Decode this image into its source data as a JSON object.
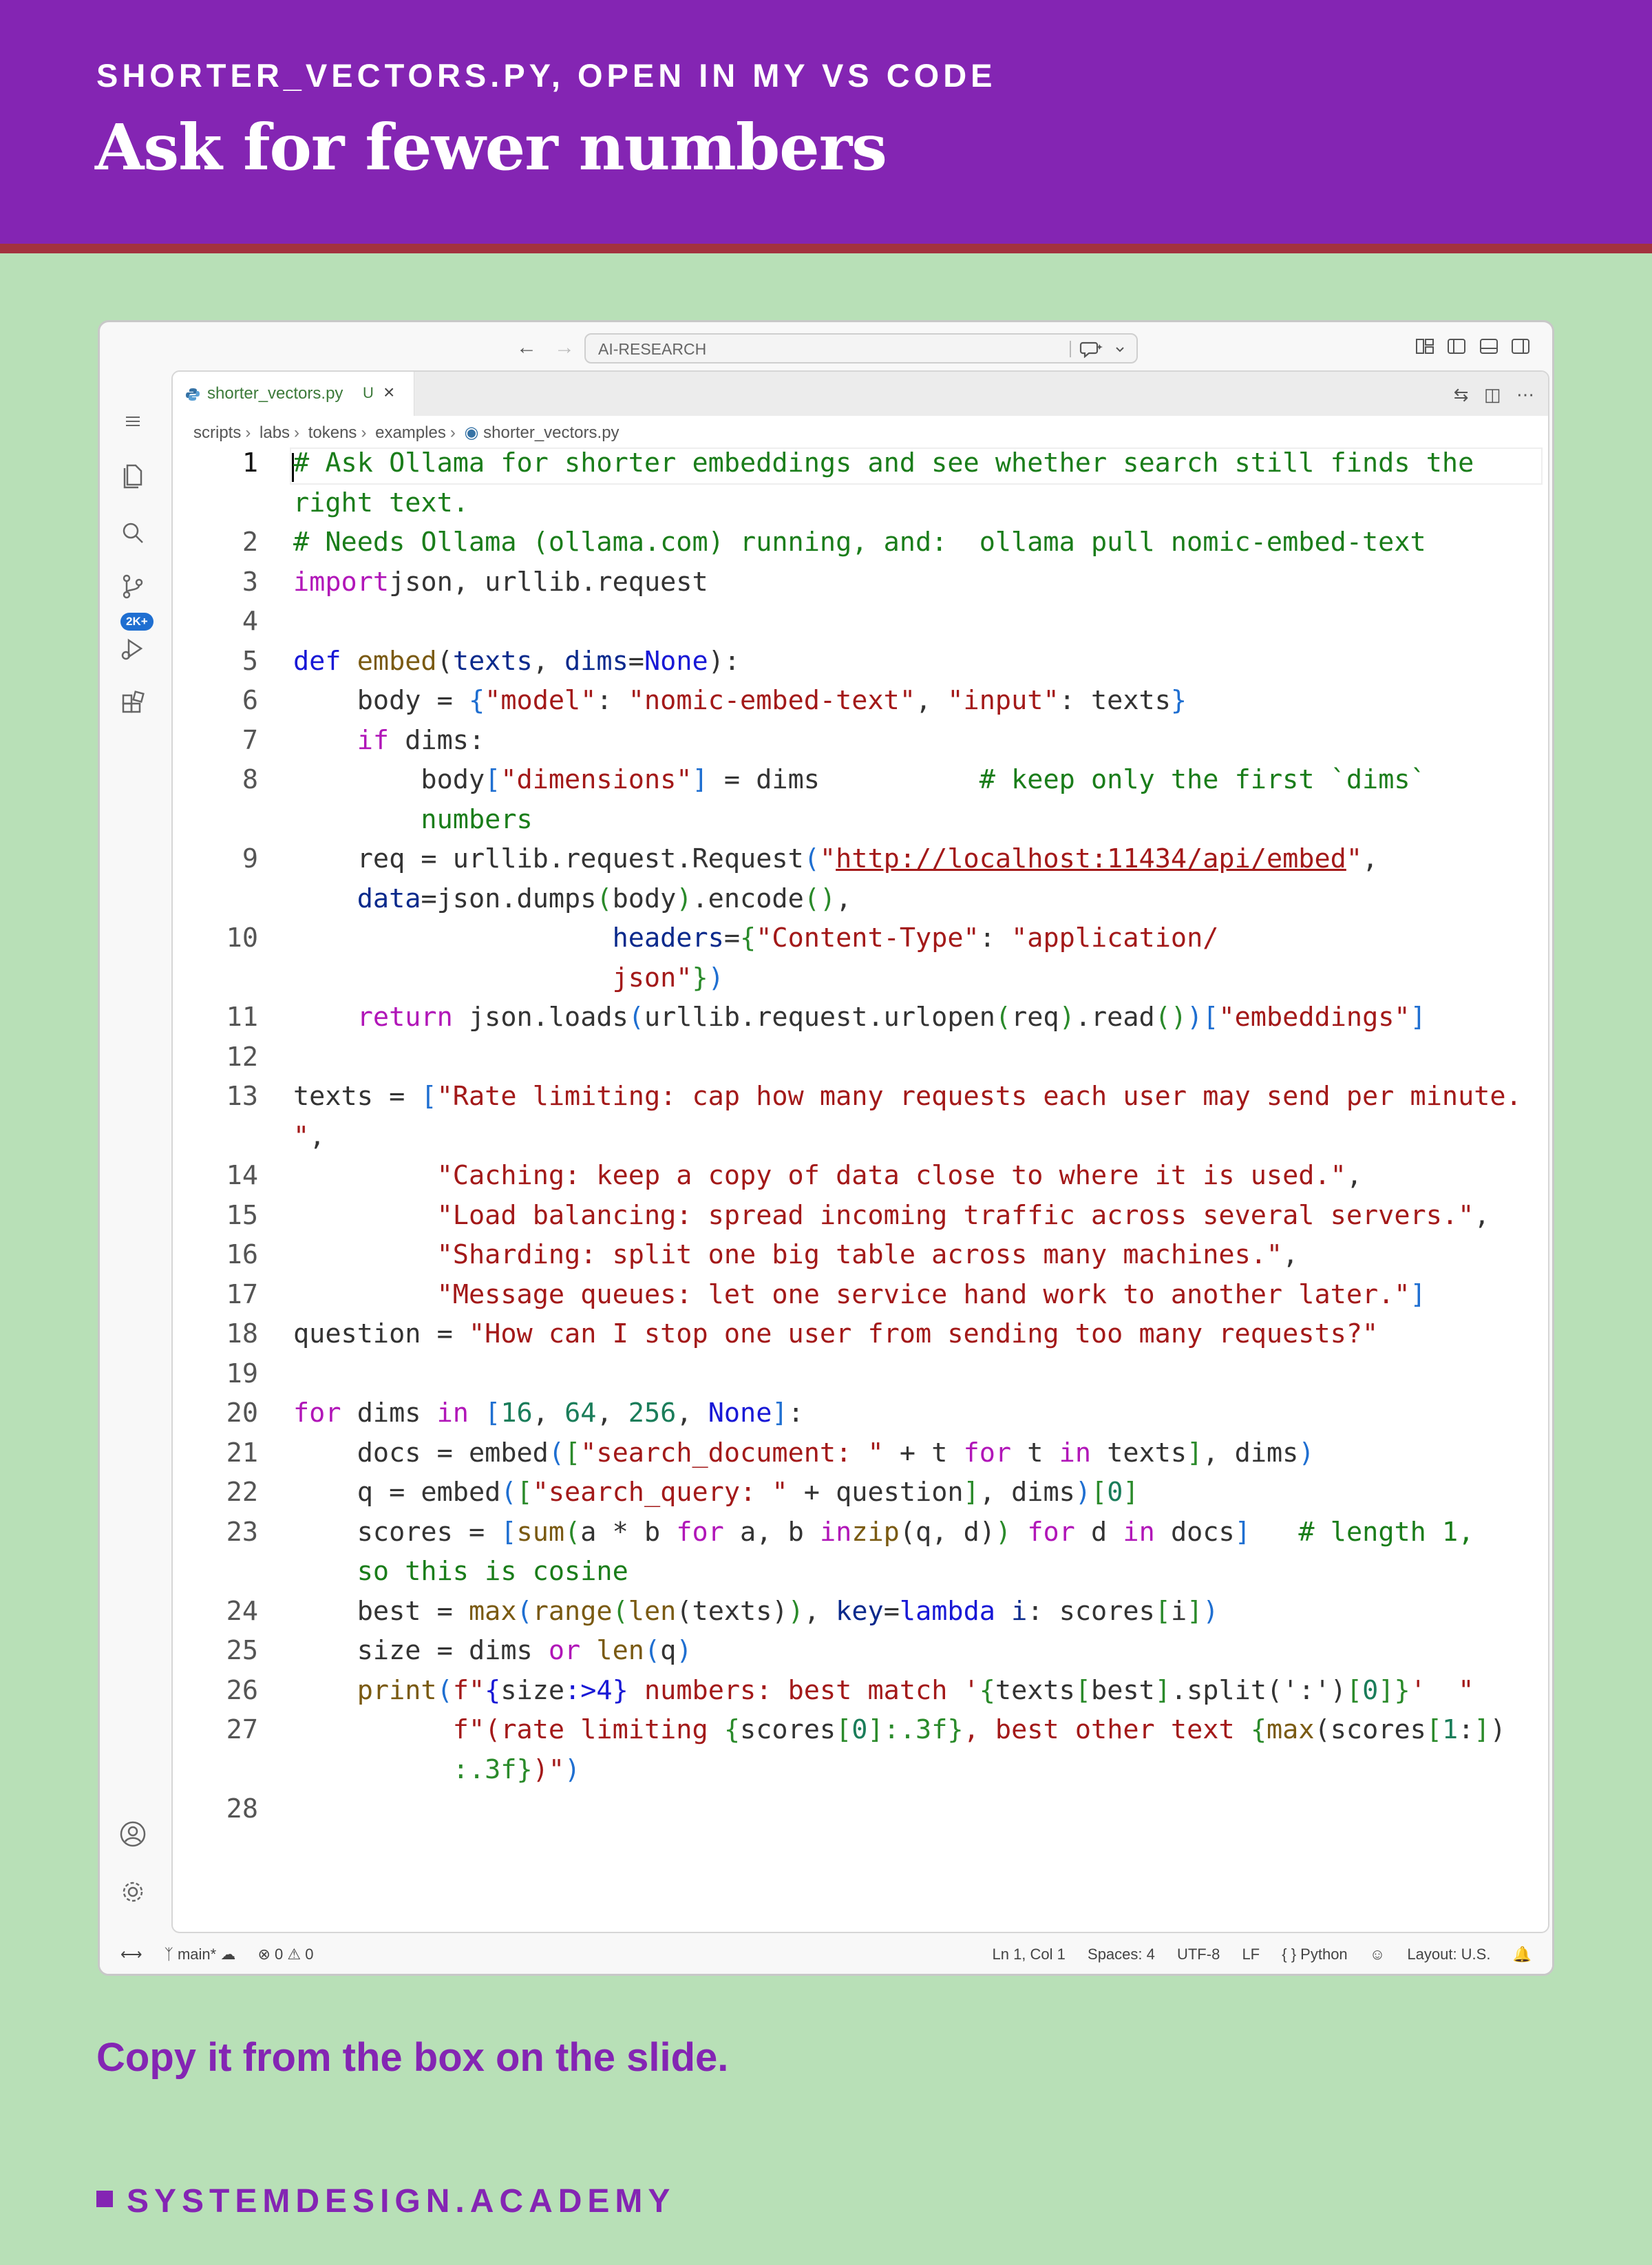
{
  "slide": {
    "kicker": "SHORTER_VECTORS.PY, OPEN IN MY VS CODE",
    "title": "Ask for fewer numbers",
    "note": "Copy it from the box on the slide.",
    "brand": "SYSTEMDESIGN.ACADEMY"
  },
  "window": {
    "command_center": "AI-RESEARCH",
    "activity_badge": "2K+"
  },
  "tab": {
    "label": "shorter_vectors.py",
    "status": "U"
  },
  "breadcrumb": [
    "scripts",
    "labs",
    "tokens",
    "examples",
    "shorter_vectors.py"
  ],
  "code_lines": [
    {
      "n": "1",
      "rows": [
        [
          [
            "c",
            "# Ask Ollama for shorter embeddings and see whether search still finds the"
          ]
        ],
        [
          [
            "c",
            "right text."
          ]
        ]
      ]
    },
    {
      "n": "2",
      "rows": [
        [
          [
            "c",
            "# Needs Ollama (ollama.com) running, and:  ollama pull nomic-embed-text"
          ]
        ]
      ]
    },
    {
      "n": "3",
      "rows": [
        [
          [
            "k",
            "import"
          ],
          [
            "",
            "json, urllib.request"
          ]
        ]
      ]
    },
    {
      "n": "4",
      "rows": [
        [
          [
            "",
            ""
          ]
        ]
      ]
    },
    {
      "n": "5",
      "rows": [
        [
          [
            "b",
            "def "
          ],
          [
            "f",
            "embed"
          ],
          [
            "",
            "("
          ],
          [
            "v",
            "texts"
          ],
          [
            "",
            ", "
          ],
          [
            "v",
            "dims"
          ],
          [
            "",
            "="
          ],
          [
            "b",
            "None"
          ],
          [
            "",
            "):"
          ]
        ]
      ]
    },
    {
      "n": "6",
      "rows": [
        [
          [
            "",
            "    body = "
          ],
          [
            "bl",
            "{"
          ],
          [
            "s",
            "\"model\""
          ],
          [
            "",
            ": "
          ],
          [
            "s",
            "\"nomic-embed-text\""
          ],
          [
            "",
            ", "
          ],
          [
            "s",
            "\"input\""
          ],
          [
            "",
            ": texts"
          ],
          [
            "bl",
            "}"
          ]
        ]
      ]
    },
    {
      "n": "7",
      "rows": [
        [
          [
            "",
            "    "
          ],
          [
            "k",
            "if"
          ],
          [
            "",
            " dims:"
          ]
        ]
      ]
    },
    {
      "n": "8",
      "rows": [
        [
          [
            "",
            "        body"
          ],
          [
            "bl",
            "["
          ],
          [
            "s",
            "\"dimensions\""
          ],
          [
            "bl",
            "]"
          ],
          [
            "",
            " = dims          "
          ],
          [
            "c",
            "# keep only the first `dims`"
          ]
        ],
        [
          [
            "c",
            "        numbers"
          ]
        ]
      ]
    },
    {
      "n": "9",
      "rows": [
        [
          [
            "",
            "    req = urllib.request.Request"
          ],
          [
            "bl",
            "("
          ],
          [
            "s",
            "\""
          ],
          [
            "su",
            "http://localhost:11434/api/embed"
          ],
          [
            "s",
            "\""
          ],
          [
            "",
            ","
          ]
        ],
        [
          [
            "",
            "    "
          ],
          [
            "v",
            "data"
          ],
          [
            "",
            "=json.dumps"
          ],
          [
            "g",
            "("
          ],
          [
            "",
            "body"
          ],
          [
            "g",
            ")"
          ],
          [
            "",
            ".encode"
          ],
          [
            "g",
            "()"
          ],
          [
            "",
            ","
          ]
        ]
      ]
    },
    {
      "n": "10",
      "rows": [
        [
          [
            "",
            "                    "
          ],
          [
            "v",
            "headers"
          ],
          [
            "",
            "="
          ],
          [
            "g",
            "{"
          ],
          [
            "s",
            "\"Content-Type\""
          ],
          [
            "",
            ": "
          ],
          [
            "s",
            "\"application/"
          ]
        ],
        [
          [
            "s",
            "                    json\""
          ],
          [
            "g",
            "}"
          ],
          [
            "bl",
            ")"
          ]
        ]
      ]
    },
    {
      "n": "11",
      "rows": [
        [
          [
            "",
            "    "
          ],
          [
            "k",
            "return"
          ],
          [
            "",
            " json.loads"
          ],
          [
            "bl",
            "("
          ],
          [
            "",
            "urllib.request.urlopen"
          ],
          [
            "g",
            "("
          ],
          [
            "",
            "req"
          ],
          [
            "g",
            ")"
          ],
          [
            "",
            ".read"
          ],
          [
            "g",
            "()"
          ],
          [
            "bl",
            ")"
          ],
          [
            "bl",
            "["
          ],
          [
            "s",
            "\"embeddings\""
          ],
          [
            "bl",
            "]"
          ]
        ]
      ]
    },
    {
      "n": "12",
      "rows": [
        [
          [
            "",
            ""
          ]
        ]
      ]
    },
    {
      "n": "13",
      "rows": [
        [
          [
            "",
            "texts = "
          ],
          [
            "bl",
            "["
          ],
          [
            "s",
            "\"Rate limiting: cap how many requests each user may send per minute."
          ]
        ],
        [
          [
            "s",
            "\""
          ],
          [
            "",
            ","
          ]
        ]
      ]
    },
    {
      "n": "14",
      "rows": [
        [
          [
            "",
            "         "
          ],
          [
            "s",
            "\"Caching: keep a copy of data close to where it is used.\""
          ],
          [
            "",
            ","
          ]
        ]
      ]
    },
    {
      "n": "15",
      "rows": [
        [
          [
            "",
            "         "
          ],
          [
            "s",
            "\"Load balancing: spread incoming traffic across several servers.\""
          ],
          [
            "",
            ","
          ]
        ]
      ]
    },
    {
      "n": "16",
      "rows": [
        [
          [
            "",
            "         "
          ],
          [
            "s",
            "\"Sharding: split one big table across many machines.\""
          ],
          [
            "",
            ","
          ]
        ]
      ]
    },
    {
      "n": "17",
      "rows": [
        [
          [
            "",
            "         "
          ],
          [
            "s",
            "\"Message queues: let one service hand work to another later.\""
          ],
          [
            "bl",
            "]"
          ]
        ]
      ]
    },
    {
      "n": "18",
      "rows": [
        [
          [
            "",
            "question = "
          ],
          [
            "s",
            "\"How can I stop one user from sending too many requests?\""
          ]
        ]
      ]
    },
    {
      "n": "19",
      "rows": [
        [
          [
            "",
            ""
          ]
        ]
      ]
    },
    {
      "n": "20",
      "rows": [
        [
          [
            "k",
            "for"
          ],
          [
            "",
            " dims "
          ],
          [
            "k",
            "in"
          ],
          [
            "",
            " "
          ],
          [
            "bl",
            "["
          ],
          [
            "n",
            "16"
          ],
          [
            "",
            ", "
          ],
          [
            "n",
            "64"
          ],
          [
            "",
            ", "
          ],
          [
            "n",
            "256"
          ],
          [
            "",
            ", "
          ],
          [
            "b",
            "None"
          ],
          [
            "bl",
            "]"
          ],
          [
            "",
            ":"
          ]
        ]
      ]
    },
    {
      "n": "21",
      "rows": [
        [
          [
            "",
            "    docs = embed"
          ],
          [
            "bl",
            "("
          ],
          [
            "g",
            "["
          ],
          [
            "s",
            "\"search_document: \""
          ],
          [
            "",
            " + t "
          ],
          [
            "k",
            "for"
          ],
          [
            "",
            " t "
          ],
          [
            "k",
            "in"
          ],
          [
            "",
            " texts"
          ],
          [
            "g",
            "]"
          ],
          [
            "",
            ", dims"
          ],
          [
            "bl",
            ")"
          ]
        ]
      ]
    },
    {
      "n": "22",
      "rows": [
        [
          [
            "",
            "    q = embed"
          ],
          [
            "bl",
            "("
          ],
          [
            "g",
            "["
          ],
          [
            "s",
            "\"search_query: \""
          ],
          [
            "",
            " + question"
          ],
          [
            "g",
            "]"
          ],
          [
            "",
            ", dims"
          ],
          [
            "bl",
            ")"
          ],
          [
            "g",
            "["
          ],
          [
            "n",
            "0"
          ],
          [
            "g",
            "]"
          ]
        ]
      ]
    },
    {
      "n": "23",
      "rows": [
        [
          [
            "",
            "    scores = "
          ],
          [
            "bl",
            "["
          ],
          [
            "f",
            "sum"
          ],
          [
            "g",
            "("
          ],
          [
            "",
            "a * b "
          ],
          [
            "k",
            "for"
          ],
          [
            "",
            " a, b "
          ],
          [
            "k",
            "in"
          ],
          [
            " f",
            "zip"
          ],
          [
            "",
            "("
          ],
          [
            "",
            "q, d"
          ],
          [
            "",
            ")"
          ],
          [
            "g",
            ")"
          ],
          [
            "",
            " "
          ],
          [
            "k",
            "for"
          ],
          [
            "",
            " d "
          ],
          [
            "k",
            "in"
          ],
          [
            "",
            " docs"
          ],
          [
            "bl",
            "]"
          ],
          [
            "",
            "   "
          ],
          [
            "c",
            "# length 1,"
          ]
        ],
        [
          [
            "c",
            "    so this is cosine"
          ]
        ]
      ]
    },
    {
      "n": "24",
      "rows": [
        [
          [
            "",
            "    best = "
          ],
          [
            "f",
            "max"
          ],
          [
            "bl",
            "("
          ],
          [
            "f",
            "range"
          ],
          [
            "g",
            "("
          ],
          [
            "f",
            "len"
          ],
          [
            "",
            "(texts)"
          ],
          [
            "g",
            ")"
          ],
          [
            "",
            ", "
          ],
          [
            "v",
            "key"
          ],
          [
            "",
            "="
          ],
          [
            "b",
            "lambda"
          ],
          [
            "",
            " "
          ],
          [
            "v",
            "i"
          ],
          [
            "",
            ": scores"
          ],
          [
            "g",
            "["
          ],
          [
            "",
            "i"
          ],
          [
            "g",
            "]"
          ],
          [
            "bl",
            ")"
          ]
        ]
      ]
    },
    {
      "n": "25",
      "rows": [
        [
          [
            "",
            "    size = dims "
          ],
          [
            "k",
            "or"
          ],
          [
            "",
            " "
          ],
          [
            "f",
            "len"
          ],
          [
            "bl",
            "("
          ],
          [
            "",
            "q"
          ],
          [
            "bl",
            ")"
          ]
        ]
      ]
    },
    {
      "n": "26",
      "rows": [
        [
          [
            "",
            "    "
          ],
          [
            "f",
            "print"
          ],
          [
            "bl",
            "("
          ],
          [
            "s",
            "f\""
          ],
          [
            "b",
            "{"
          ],
          [
            "",
            "size"
          ],
          [
            "b",
            ":>4}"
          ],
          [
            "s",
            " numbers: best match '"
          ],
          [
            "g",
            "{"
          ],
          [
            "",
            "texts"
          ],
          [
            "g",
            "["
          ],
          [
            "",
            "best"
          ],
          [
            "g",
            "]"
          ],
          [
            "",
            ".split"
          ],
          [
            "",
            "('"
          ],
          [
            "",
            ":"
          ],
          [
            "",
            "')"
          ],
          [
            "g",
            "["
          ],
          [
            "n",
            "0"
          ],
          [
            "g",
            "]"
          ],
          [
            "g",
            "}"
          ],
          [
            "s",
            "'  \""
          ]
        ]
      ]
    },
    {
      "n": "27",
      "rows": [
        [
          [
            "",
            "          "
          ],
          [
            "s",
            "f\"(rate limiting "
          ],
          [
            "g",
            "{"
          ],
          [
            "",
            "scores"
          ],
          [
            "g",
            "["
          ],
          [
            "n",
            "0"
          ],
          [
            "g",
            "]"
          ],
          [
            "g",
            ":.3f}"
          ],
          [
            "s",
            ", best other text "
          ],
          [
            "g",
            "{"
          ],
          [
            "f",
            "max"
          ],
          [
            "",
            "(scores"
          ],
          [
            "g",
            "["
          ],
          [
            "n",
            "1"
          ],
          [
            "",
            ":"
          ],
          [
            "g",
            "]"
          ],
          [
            "",
            ")"
          ]
        ],
        [
          [
            "g",
            "          :.3f}"
          ],
          [
            "s",
            ")\""
          ],
          [
            "bl",
            ")"
          ]
        ]
      ]
    },
    {
      "n": "28",
      "rows": [
        [
          [
            "",
            ""
          ]
        ]
      ]
    }
  ],
  "status": {
    "branch": "main*",
    "errors": "0",
    "warnings": "0",
    "cursor": "Ln 1, Col 1",
    "spaces": "Spaces: 4",
    "encoding": "UTF-8",
    "eol": "LF",
    "language": "Python",
    "layout": "Layout: U.S."
  },
  "colors": {
    "header": "#8425b3",
    "header_rule": "#a3323f",
    "background": "#b8e0b7",
    "comment": "#1a7d1a",
    "keyword": "#b116b8",
    "string": "#a31919"
  },
  "icons": [
    "menu-icon",
    "explorer-icon",
    "search-icon",
    "source-control-icon",
    "run-debug-icon",
    "extensions-icon",
    "account-icon",
    "gear-icon",
    "back-arrow-icon",
    "forward-arrow-icon",
    "chat-icon",
    "python-file-icon",
    "close-icon",
    "split-editor-icon",
    "more-icon",
    "bell-icon",
    "copilot-icon"
  ]
}
